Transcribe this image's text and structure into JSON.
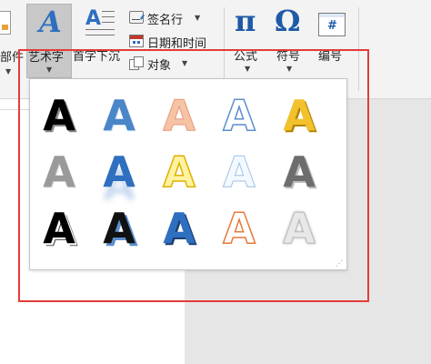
{
  "ribbon": {
    "parts_label": "部件",
    "wordart": {
      "label": "艺术字",
      "glyph": "A"
    },
    "dropcap": {
      "label": "首字下沉",
      "glyph": "A"
    },
    "signature_line": {
      "label": "签名行"
    },
    "datetime": {
      "label": "日期和时间"
    },
    "object": {
      "label": "对象"
    },
    "equation": {
      "label": "公式",
      "glyph": "π"
    },
    "symbol": {
      "label": "符号",
      "glyph": "Ω"
    },
    "numbering": {
      "label": "编号",
      "glyph": "#"
    }
  },
  "gallery": {
    "styles": [
      {
        "glyph": "A",
        "style": "black-fill-shadow"
      },
      {
        "glyph": "A",
        "style": "blue-gradient"
      },
      {
        "glyph": "A",
        "style": "orange-soft"
      },
      {
        "glyph": "A",
        "style": "blue-outline-white"
      },
      {
        "glyph": "A",
        "style": "gold-bevel"
      },
      {
        "glyph": "A",
        "style": "gray-gradient"
      },
      {
        "glyph": "A",
        "style": "blue-reflection"
      },
      {
        "glyph": "A",
        "style": "yellow-outline"
      },
      {
        "glyph": "A",
        "style": "light-blue-outline"
      },
      {
        "glyph": "A",
        "style": "gray-3d"
      },
      {
        "glyph": "A",
        "style": "black-white-outline"
      },
      {
        "glyph": "A",
        "style": "black-blue-shadow"
      },
      {
        "glyph": "A",
        "style": "blue-3d"
      },
      {
        "glyph": "A",
        "style": "orange-outline"
      },
      {
        "glyph": "A",
        "style": "silver-glow"
      }
    ]
  },
  "colors": {
    "highlight_box": "#e53b3b",
    "accent_blue": "#2f6fbf",
    "ribbon_bg": "#f3f3f3"
  }
}
